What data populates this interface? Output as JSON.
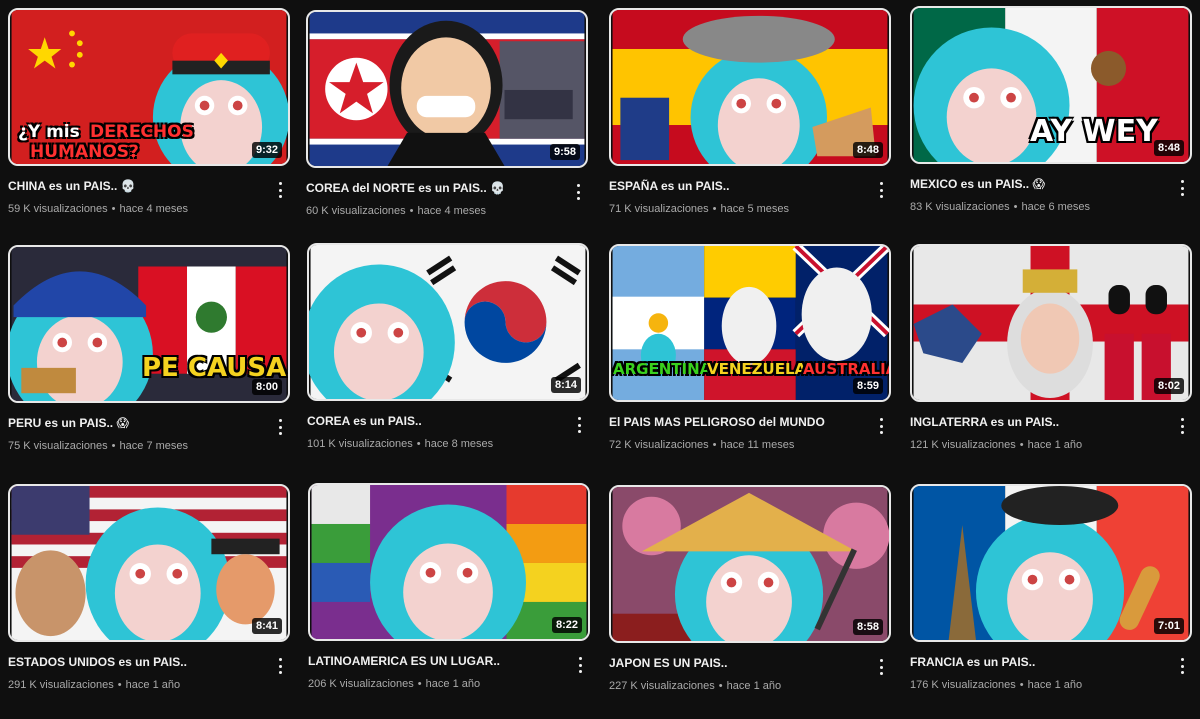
{
  "videos": [
    {
      "title": "CHINA es un PAIS.. 💀",
      "views": "59 K visualizaciones",
      "age": "hace 4 meses",
      "duration": "9:32",
      "overlay": "¿Y mis DERECHOS HUMANOS?",
      "flag": "china"
    },
    {
      "title": "COREA del NORTE es un PAIS.. 💀",
      "views": "60 K visualizaciones",
      "age": "hace 4 meses",
      "duration": "9:58",
      "overlay": "",
      "flag": "north-korea"
    },
    {
      "title": "ESPAÑA es un PAIS..",
      "views": "71 K visualizaciones",
      "age": "hace 5 meses",
      "duration": "8:48",
      "overlay": "",
      "flag": "spain"
    },
    {
      "title": "MEXICO es un PAIS.. 😱",
      "views": "83 K visualizaciones",
      "age": "hace 6 meses",
      "duration": "8:48",
      "overlay": "AY WEY",
      "flag": "mexico"
    },
    {
      "title": "PERU es un PAIS.. 😱",
      "views": "75 K visualizaciones",
      "age": "hace 7 meses",
      "duration": "8:00",
      "overlay": "PE CAUSA",
      "flag": "peru"
    },
    {
      "title": "COREA es un PAIS..",
      "views": "101 K visualizaciones",
      "age": "hace 8 meses",
      "duration": "8:14",
      "overlay": "",
      "flag": "south-korea"
    },
    {
      "title": "El PAIS MAS PELIGROSO del MUNDO",
      "views": "72 K visualizaciones",
      "age": "hace 11 meses",
      "duration": "8:59",
      "overlay": "ARGENTINA VENEZUELA AUSTRALIA",
      "flag": "multi"
    },
    {
      "title": "INGLATERRA es un PAIS..",
      "views": "121 K visualizaciones",
      "age": "hace 1 año",
      "duration": "8:02",
      "overlay": "",
      "flag": "england"
    },
    {
      "title": "ESTADOS UNIDOS es un PAIS..",
      "views": "291 K visualizaciones",
      "age": "hace 1 año",
      "duration": "8:41",
      "overlay": "",
      "flag": "usa"
    },
    {
      "title": "LATINOAMERICA ES UN LUGAR..",
      "views": "206 K visualizaciones",
      "age": "hace 1 año",
      "duration": "8:22",
      "overlay": "",
      "flag": "wiphala"
    },
    {
      "title": "JAPON ES UN PAIS..",
      "views": "227 K visualizaciones",
      "age": "hace 1 año",
      "duration": "8:58",
      "overlay": "",
      "flag": "japan"
    },
    {
      "title": "FRANCIA es un PAIS..",
      "views": "176 K visualizaciones",
      "age": "hace 1 año",
      "duration": "7:01",
      "overlay": "",
      "flag": "france"
    }
  ],
  "overlays": {
    "china_1": "¿Y mis",
    "china_2": "DERECHOS",
    "china_3": "HUMANOS?",
    "mexico": "AY WEY",
    "peru": "PE CAUSA",
    "multi_1": "ARGENTINA",
    "multi_2": "VENEZUELA",
    "multi_3": "AUSTRALIA"
  },
  "colors": {
    "background": "#0f0f0f",
    "title": "#f1f1f1",
    "meta": "#aaaaaa",
    "hair": "#2ec4d6"
  }
}
